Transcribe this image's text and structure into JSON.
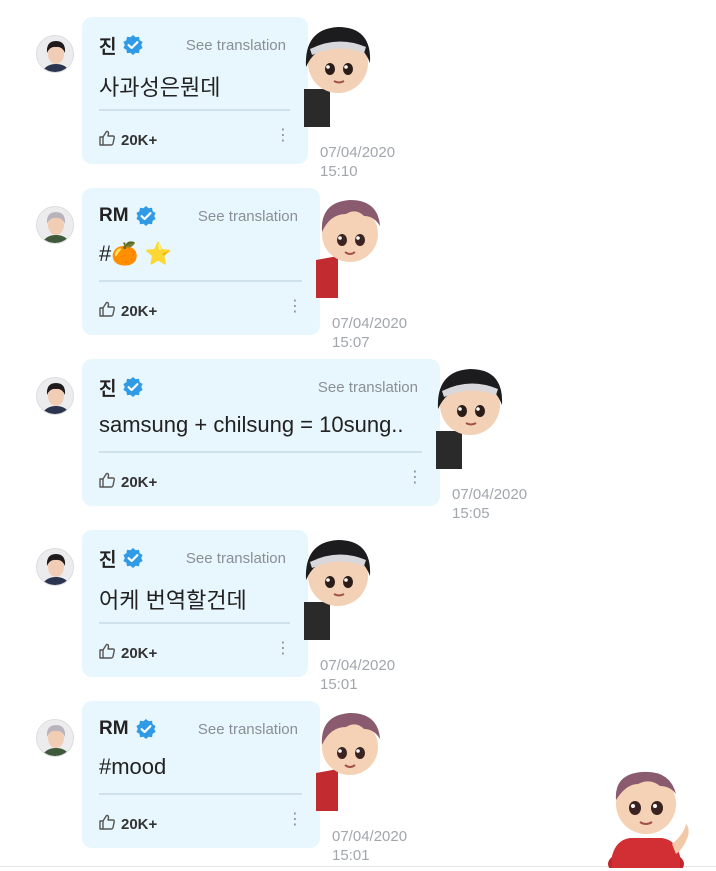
{
  "messages": [
    {
      "author": "진",
      "author_type": "jin",
      "see_translation": "See translation",
      "text": "사과성은뭔데",
      "likes": "20K+",
      "more": "⋮",
      "date": "07/04/2020",
      "time": "15:10"
    },
    {
      "author": "RM",
      "author_type": "rm",
      "see_translation": "See translation",
      "text": "#🍊 ⭐",
      "likes": "20K+",
      "more": "⋮",
      "date": "07/04/2020",
      "time": "15:07"
    },
    {
      "author": "진",
      "author_type": "jin",
      "see_translation": "See translation",
      "text": "samsung + chilsung = 10sung..",
      "likes": "20K+",
      "more": "⋮",
      "date": "07/04/2020",
      "time": "15:05"
    },
    {
      "author": "진",
      "author_type": "jin",
      "see_translation": "See translation",
      "text": "어케 번역할건데",
      "likes": "20K+",
      "more": "⋮",
      "date": "07/04/2020",
      "time": "15:01"
    },
    {
      "author": "RM",
      "author_type": "rm",
      "see_translation": "See translation",
      "text": "#mood",
      "likes": "20K+",
      "more": "⋮",
      "date": "07/04/2020",
      "time": "15:01"
    }
  ],
  "icons": {
    "verified": "verified-badge-icon",
    "like": "thumbs-up-icon",
    "more": "more-vertical-icon"
  },
  "colors": {
    "bubble": "#e8f6fd",
    "verified": "#2f9be7",
    "secondary_text": "#8a8f96",
    "timestamp": "#a2a7ad"
  }
}
